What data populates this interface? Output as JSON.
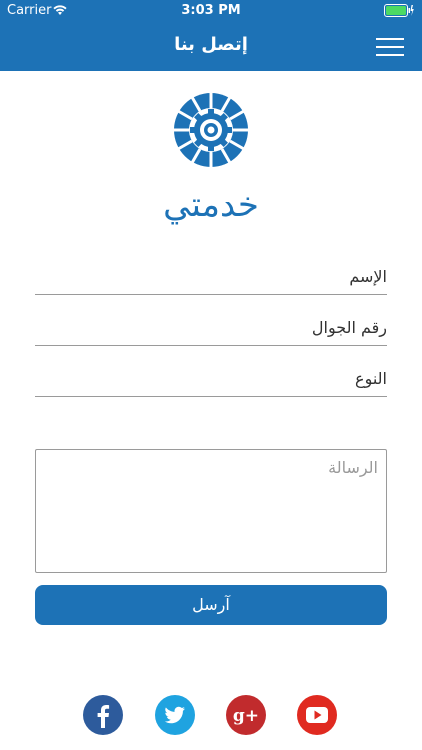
{
  "status_bar": {
    "carrier": "Carrier",
    "time": "3:03 PM"
  },
  "nav": {
    "title": "إتصل بنا"
  },
  "brand": {
    "name": "خدمتي"
  },
  "form": {
    "name_placeholder": "الإسم",
    "phone_placeholder": "رقم الجوال",
    "type_placeholder": "النوع",
    "message_placeholder": "الرسالة",
    "send_label": "آرسل"
  },
  "social": [
    "facebook-icon",
    "twitter-icon",
    "google-plus-icon",
    "youtube-icon"
  ],
  "colors": {
    "primary": "#1d72b6",
    "facebook": "#2d5b9c",
    "twitter": "#1fa3e0",
    "google_plus": "#c12b2d",
    "youtube": "#e02a20"
  }
}
